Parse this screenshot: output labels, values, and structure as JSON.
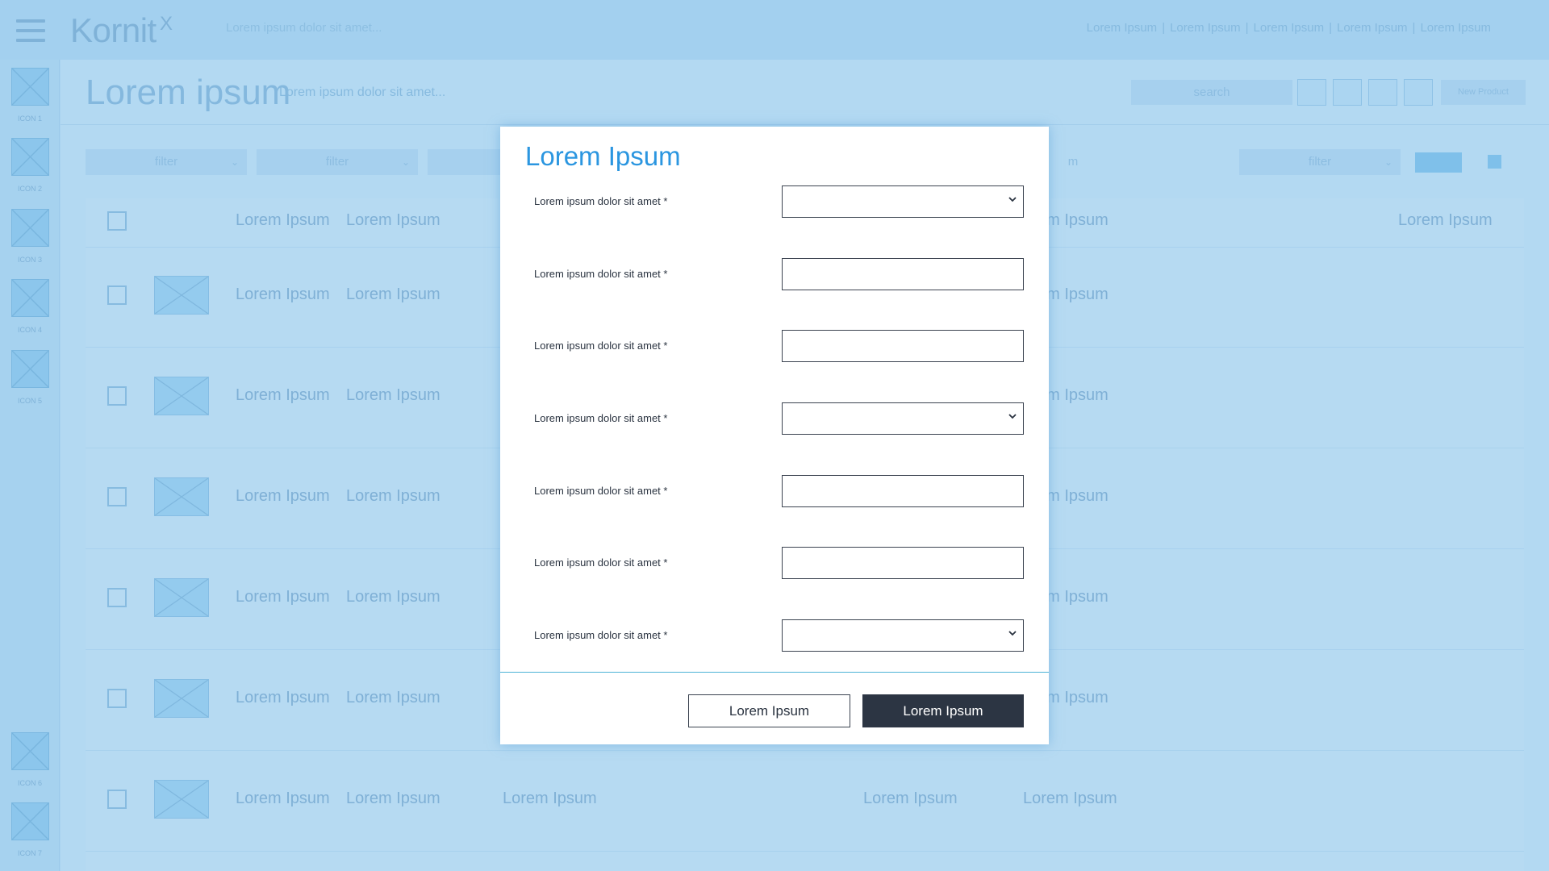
{
  "header": {
    "logo": "Kornit",
    "logo_sup": "X",
    "tagline": "Lorem ipsum dolor sit amet...",
    "links": [
      "Lorem Ipsum",
      "Lorem Ipsum",
      "Lorem Ipsum",
      "Lorem Ipsum",
      "Lorem Ipsum"
    ],
    "separator": "|"
  },
  "sidebar": {
    "items": [
      {
        "label": "ICON 1"
      },
      {
        "label": "ICON 2"
      },
      {
        "label": "ICON 3"
      },
      {
        "label": "ICON 4"
      },
      {
        "label": "ICON 5"
      },
      {
        "label": "ICON 6"
      },
      {
        "label": "ICON 7"
      }
    ]
  },
  "page": {
    "title": "Lorem ipsum",
    "subtitle": "Lorem ipsum dolor sit amet...",
    "search_placeholder": "search",
    "new_product": "New Product"
  },
  "filters": [
    "filter",
    "filter",
    "filter"
  ],
  "table": {
    "header": [
      "Lorem Ipsum",
      "Lorem Ipsum",
      "em Ipsum",
      "Lorem Ipsum"
    ],
    "rows": [
      [
        "Lorem Ipsum",
        "Lorem Ipsum",
        "em Ipsum"
      ],
      [
        "Lorem Ipsum",
        "Lorem Ipsum",
        "em Ipsum"
      ],
      [
        "Lorem Ipsum",
        "Lorem Ipsum",
        "em Ipsum"
      ],
      [
        "Lorem Ipsum",
        "Lorem Ipsum",
        "em Ipsum"
      ],
      [
        "Lorem Ipsum",
        "Lorem Ipsum",
        "em Ipsum"
      ],
      [
        "Lorem Ipsum",
        "Lorem Ipsum",
        "Lorem Ipsum",
        "Lorem Ipsum",
        "Lorem Ipsum"
      ]
    ],
    "partial_filter_text": "m"
  },
  "modal": {
    "title": "Lorem Ipsum",
    "fields": [
      {
        "label": "Lorem ipsum dolor sit amet *",
        "type": "select",
        "value": ""
      },
      {
        "label": "Lorem ipsum dolor sit amet *",
        "type": "text",
        "value": ""
      },
      {
        "label": "Lorem ipsum dolor sit amet *",
        "type": "text",
        "value": ""
      },
      {
        "label": "Lorem ipsum dolor sit amet *",
        "type": "select",
        "value": ""
      },
      {
        "label": "Lorem ipsum dolor sit amet *",
        "type": "text",
        "value": ""
      },
      {
        "label": "Lorem ipsum dolor sit amet *",
        "type": "text",
        "value": ""
      },
      {
        "label": "Lorem ipsum dolor sit amet *",
        "type": "select",
        "value": ""
      }
    ],
    "cancel_label": "Lorem Ipsum",
    "submit_label": "Lorem Ipsum"
  },
  "colors": {
    "background": "#a9d3f0",
    "modal_title": "#2b96e0",
    "submit_button": "#2c3543",
    "divider": "#4cb3d6"
  }
}
